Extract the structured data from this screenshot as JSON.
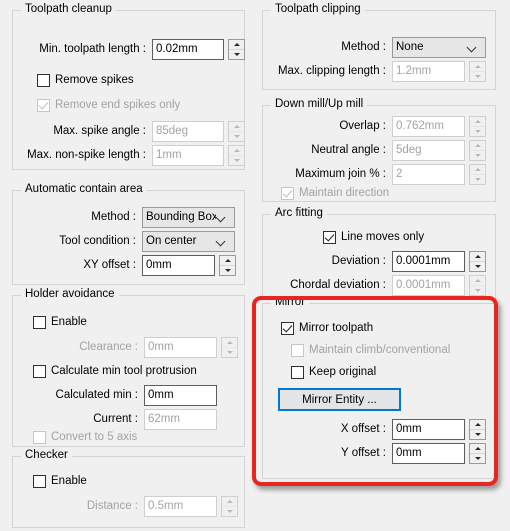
{
  "colors": {
    "highlight": "#e8251f",
    "focus": "#0078d7",
    "disabled_text": "#a3a3a3",
    "dialog_bg": "#f0f0f0"
  },
  "left_column": {
    "toolpath_cleanup": {
      "title": "Toolpath cleanup",
      "min_length_label": "Min. toolpath length :",
      "min_length_value": "0.02mm",
      "remove_spikes_label": "Remove spikes",
      "remove_end_spikes_label": "Remove end spikes only",
      "max_spike_angle_label": "Max. spike angle :",
      "max_spike_angle_value": "85deg",
      "max_nonspike_label": "Max. non-spike length :",
      "max_nonspike_value": "1mm"
    },
    "automatic_contain_area": {
      "title": "Automatic contain area",
      "method_label": "Method :",
      "method_value": "Bounding Box",
      "tool_condition_label": "Tool condition :",
      "tool_condition_value": "On center",
      "xy_offset_label": "XY offset :",
      "xy_offset_value": "0mm"
    },
    "holder_avoidance": {
      "title": "Holder avoidance",
      "enable_label": "Enable",
      "clearance_label": "Clearance :",
      "clearance_value": "0mm",
      "calc_min_protrusion_label": "Calculate min tool protrusion",
      "calculated_min_label": "Calculated min :",
      "calculated_min_value": "0mm",
      "current_label": "Current :",
      "current_value": "62mm",
      "convert_5axis_label": "Convert to 5 axis"
    },
    "checker": {
      "title": "Checker",
      "enable_label": "Enable",
      "distance_label": "Distance :",
      "distance_value": "0.5mm"
    }
  },
  "right_column": {
    "toolpath_clipping": {
      "title": "Toolpath clipping",
      "method_label": "Method :",
      "method_value": "None",
      "max_clipping_label": "Max. clipping length :",
      "max_clipping_value": "1.2mm"
    },
    "down_up_mill": {
      "title": "Down mill/Up mill",
      "overlap_label": "Overlap :",
      "overlap_value": "0.762mm",
      "neutral_angle_label": "Neutral angle :",
      "neutral_angle_value": "5deg",
      "maximum_join_label": "Maximum join % :",
      "maximum_join_value": "2",
      "maintain_direction_label": "Maintain direction"
    },
    "arc_fitting": {
      "title": "Arc fitting",
      "line_moves_only_label": "Line moves only",
      "deviation_label": "Deviation :",
      "deviation_value": "0.0001mm",
      "chordal_deviation_label": "Chordal deviation :",
      "chordal_deviation_value": "0.0001mm"
    },
    "mirror": {
      "title": "Mirror",
      "mirror_toolpath_label": "Mirror toolpath",
      "maintain_climb_label": "Maintain climb/conventional",
      "keep_original_label": "Keep original",
      "mirror_entity_button": "Mirror Entity ...",
      "x_offset_label": "X offset :",
      "x_offset_value": "0mm",
      "y_offset_label": "Y offset :",
      "y_offset_value": "0mm"
    }
  }
}
